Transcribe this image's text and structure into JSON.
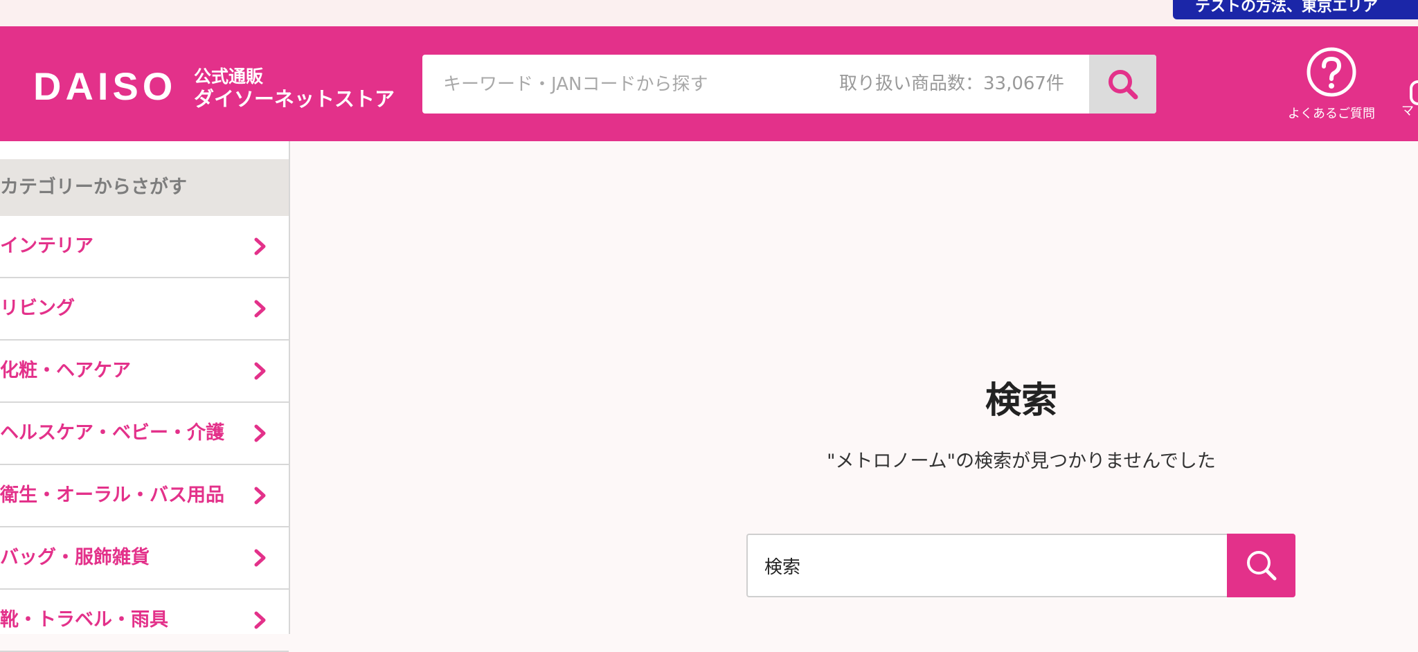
{
  "top_notice": {
    "text": "テストの方法、東京エリア"
  },
  "brand": {
    "logo_text": "DAISO",
    "sub_line1": "公式通販",
    "sub_line2": "ダイソーネットストア",
    "color": "#e3318a"
  },
  "header_search": {
    "placeholder": "キーワード・JANコードから探す",
    "product_count": "取り扱い商品数：33,067件",
    "button_icon": "search-icon"
  },
  "header_links": {
    "faq_label": "よくあるご質問",
    "faq_icon": "question-circle-icon",
    "my_label_partial": "マ"
  },
  "sidebar": {
    "heading": "カテゴリーからさがす",
    "items": [
      {
        "label": "インテリア"
      },
      {
        "label": "リビング"
      },
      {
        "label": "化粧・ヘアケア"
      },
      {
        "label": "ヘルスケア・ベビー・介護"
      },
      {
        "label": "衛生・オーラル・バス用品"
      },
      {
        "label": "バッグ・服飾雑貨"
      },
      {
        "label": "靴・トラベル・雨具"
      }
    ]
  },
  "main": {
    "title": "検索",
    "message": "\"メトロノーム\"の検索が見つかりませんでした",
    "search_value": "検索",
    "search_button_icon": "search-icon"
  }
}
